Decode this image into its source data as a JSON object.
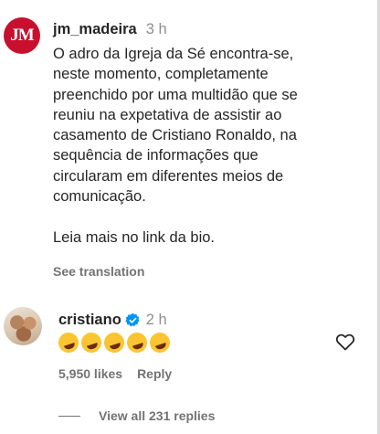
{
  "comment1": {
    "avatar_text": "JM",
    "username": "jm_madeira",
    "time": "3 h",
    "text": "O adro da Igreja da Sé encontra-se,\nneste momento, completamente\npreenchido por uma multidão que se\nreuniu na expetativa de assistir ao\ncasamento de Cristiano Ronaldo, na\nsequência de informações que\ncircularam em diferentes meios de\ncomunicação.\n\nLeia mais no link da bio.",
    "see_translation": "See translation"
  },
  "comment2": {
    "username": "cristiano",
    "time": "2 h",
    "emojis": [
      "🤣",
      "🤣",
      "🤣",
      "🤣",
      "🤣"
    ],
    "likes": "5,950 likes",
    "reply_label": "Reply",
    "view_replies": "View all 231 replies"
  },
  "colors": {
    "brand_jm": "#c8102e",
    "verified": "#0095f6",
    "muted": "#737373"
  },
  "icons": {
    "verified": "verified-badge-icon",
    "like": "heart-icon"
  }
}
